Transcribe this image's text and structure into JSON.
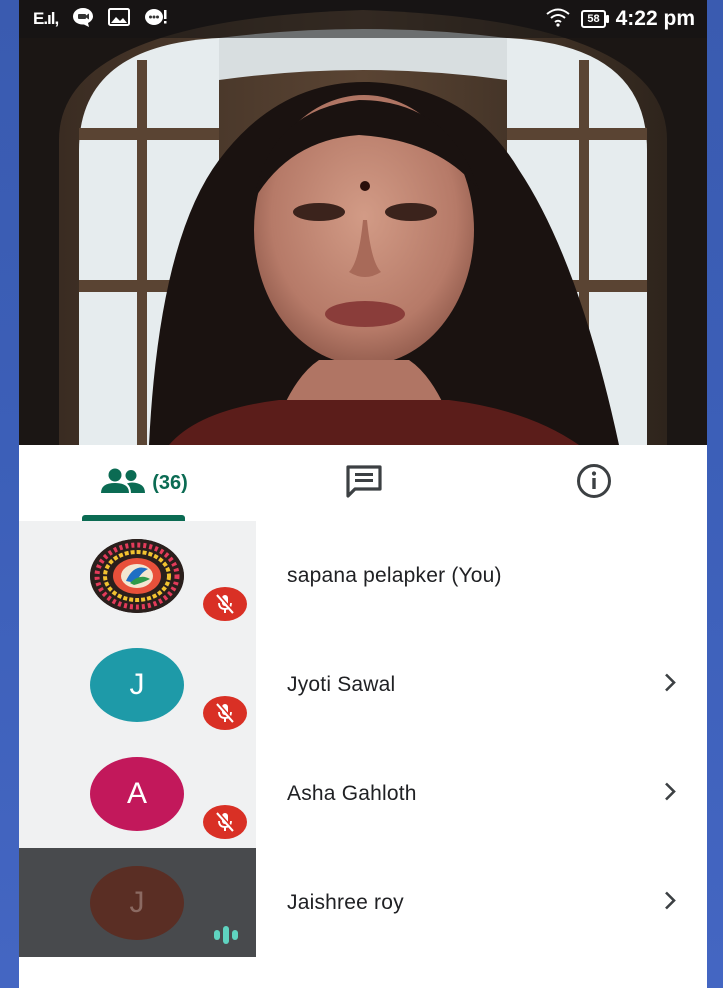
{
  "status_bar": {
    "signal": "E.ıl,",
    "battery": "58",
    "time": "4:22 pm",
    "icons": [
      "chat-bubble-icon",
      "gallery-icon",
      "notification-icon",
      "wifi-icon",
      "battery-icon"
    ]
  },
  "tabs": {
    "people_count": "(36)",
    "icons": [
      "people-icon",
      "chat-icon",
      "info-icon"
    ]
  },
  "participants": [
    {
      "name": "sapana pelapker (You)",
      "avatar_letter": "",
      "avatar_kind": "image",
      "mic": "muted",
      "has_chevron": false
    },
    {
      "name": "Jyoti Sawal",
      "avatar_letter": "J",
      "avatar_color": "#1e9aa8",
      "mic": "muted",
      "has_chevron": true
    },
    {
      "name": "Asha Gahloth",
      "avatar_letter": "A",
      "avatar_color": "#c2185b",
      "mic": "muted",
      "has_chevron": true
    },
    {
      "name": "Jaishree roy",
      "avatar_letter": "J",
      "avatar_color": "#5a2e24",
      "mic": "speaking",
      "has_chevron": true
    }
  ],
  "colors": {
    "accent": "#0b6b53",
    "mute": "#d93025",
    "speaking": "#5fd3c0",
    "active_row": "#484a4d"
  }
}
